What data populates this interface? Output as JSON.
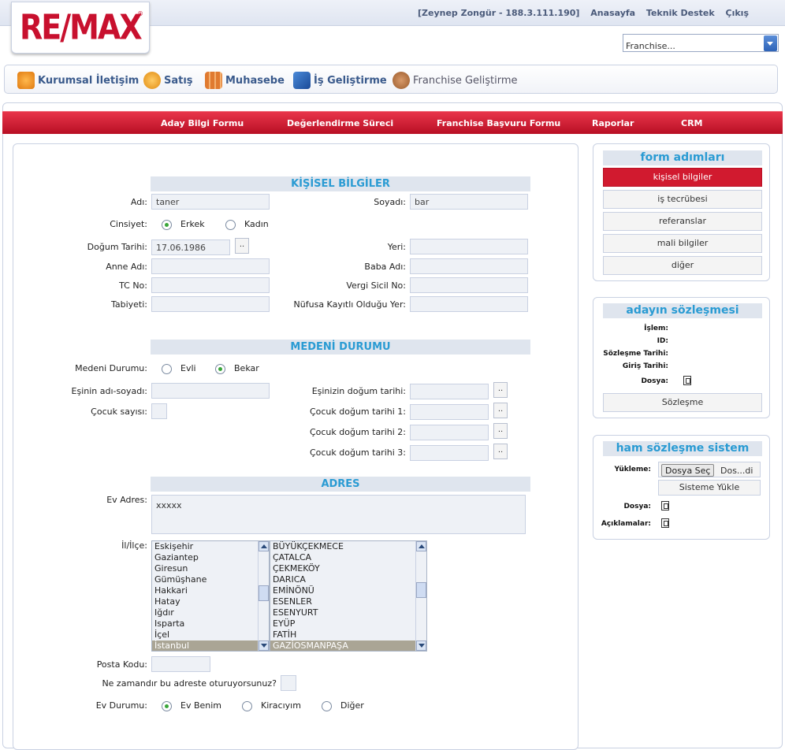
{
  "header": {
    "logo_text": "RE/MAX",
    "user_info": "[Zeynep Zongür - 188.3.111.190]",
    "links": [
      "Anasayfa",
      "Teknik Destek",
      "Çıkış"
    ],
    "franchise_select": {
      "value": "Franchise..."
    }
  },
  "modules": [
    {
      "label": "Kurumsal İletişim",
      "icon": "people-icon",
      "color": "#f0a030"
    },
    {
      "label": "Satış",
      "icon": "sales-icon",
      "color": "#f0a030"
    },
    {
      "label": "Muhasebe",
      "icon": "blocks-icon",
      "color": "#e07a30"
    },
    {
      "label": "İş Geliştirme",
      "icon": "chart-icon",
      "color": "#2a6ab8"
    },
    {
      "label": "Franchise Geliştirme",
      "icon": "handshake-icon",
      "color": "#b06a3a"
    }
  ],
  "nav": [
    "Aday Bilgi Formu",
    "Değerlendirme Süreci",
    "Franchise Başvuru Formu",
    "Raporlar",
    "CRM"
  ],
  "personal": {
    "title": "KİŞİSEL BİLGİLER",
    "ad_label": "Adı:",
    "ad_value": "taner",
    "soyad_label": "Soyadı:",
    "soyad_value": "bar",
    "cinsiyet_label": "Cinsiyet:",
    "erkek": "Erkek",
    "kadin": "Kadın",
    "dogum_label": "Doğum Tarihi:",
    "dogum_value": "17.06.1986",
    "pick": "..",
    "yeri_label": "Yeri:",
    "anne_label": "Anne Adı:",
    "baba_label": "Baba Adı:",
    "tc_label": "TC No:",
    "vergi_label": "Vergi Sicil No:",
    "tabiyet_label": "Tabiyeti:",
    "nufus_label": "Nüfusa Kayıtlı Olduğu Yer:"
  },
  "medeni": {
    "title": "MEDENİ DURUMU",
    "durum_label": "Medeni Durumu:",
    "evli": "Evli",
    "bekar": "Bekar",
    "es_adi_label": "Eşinin adı-soyadı:",
    "es_dogum_label": "Eşinizin doğum tarihi:",
    "cocuk_sayisi_label": "Çocuk sayısı:",
    "cocuk1_label": "Çocuk doğum tarihi 1:",
    "cocuk2_label": "Çocuk doğum tarihi 2:",
    "cocuk3_label": "Çocuk doğum tarihi 3:"
  },
  "adres": {
    "title": "ADRES",
    "ev_adres_label": "Ev Adres:",
    "ev_adres_value": "xxxxx",
    "il_ilce_label": "İl/İlçe:",
    "iller": [
      "Eskişehir",
      "Gaziantep",
      "Giresun",
      "Gümüşhane",
      "Hakkari",
      "Hatay",
      "Iğdır",
      "Isparta",
      "İçel",
      "İstanbul"
    ],
    "ilceler": [
      "BÜYÜKÇEKMECE",
      "ÇATALCA",
      "ÇEKMEKÖY",
      "DARICA",
      "EMİNÖNÜ",
      "ESENLER",
      "ESENYURT",
      "EYÜP",
      "FATİH",
      "GAZİOSMANPAŞA"
    ],
    "posta_label": "Posta Kodu:",
    "ne_zaman_label": "Ne zamandır bu adreste oturuyorsunuz?",
    "ev_durumu_label": "Ev Durumu:",
    "ev_benim": "Ev Benim",
    "kiraciyim": "Kiracıyım",
    "diger": "Diğer"
  },
  "form_steps": {
    "title": "form adımları",
    "items": [
      "kişisel bilgiler",
      "iş tecrübesi",
      "referanslar",
      "mali bilgiler",
      "diğer"
    ]
  },
  "sozlesme": {
    "title": "adayın sözleşmesi",
    "islem_label": "İşlem:",
    "id_label": "ID:",
    "tarih_label": "Sözleşme Tarihi:",
    "giris_label": "Giriş Tarihi:",
    "dosya_label": "Dosya:",
    "button": "Sözleşme"
  },
  "ham": {
    "title": "ham sözleşme sistem",
    "yukleme_label": "Yükleme:",
    "dosya_sec": "Dosya Seç",
    "dosya_durum": "Dos...di",
    "yukle_button": "Sisteme Yükle",
    "dosya_label": "Dosya:",
    "aciklama_label": "Açıklamalar:"
  }
}
